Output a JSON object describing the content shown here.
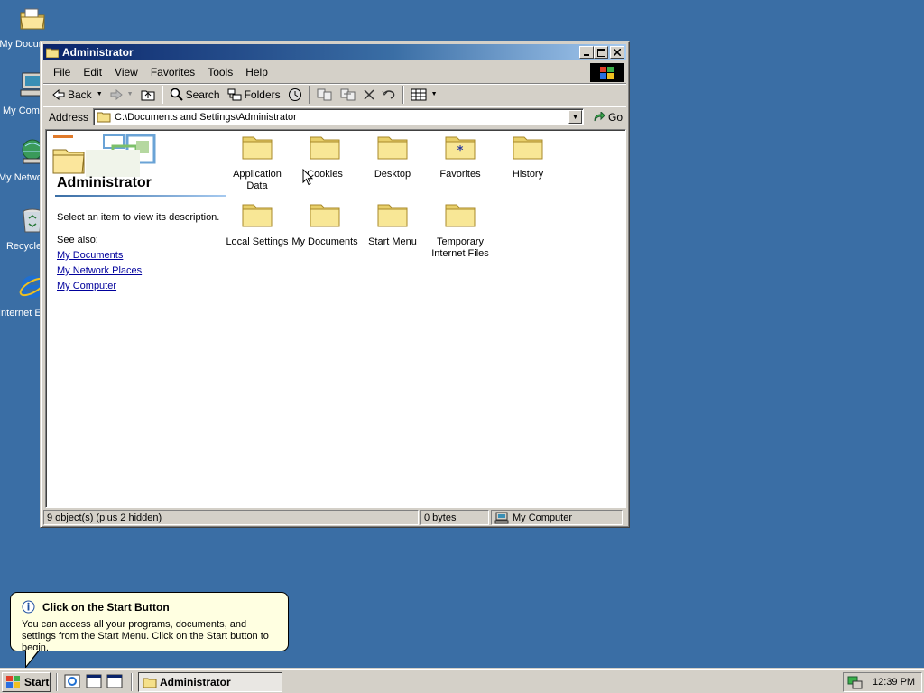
{
  "desktop": {
    "icons": [
      {
        "label": "My Documents",
        "icon": "my-documents-icon"
      },
      {
        "label": "My Computer",
        "icon": "my-computer-icon"
      },
      {
        "label": "My Network Places",
        "icon": "network-places-icon"
      },
      {
        "label": "Recycle Bin",
        "icon": "recycle-bin-icon"
      },
      {
        "label": "Internet Explorer",
        "icon": "internet-explorer-icon"
      }
    ]
  },
  "window": {
    "title": "Administrator",
    "menu": [
      "File",
      "Edit",
      "View",
      "Favorites",
      "Tools",
      "Help"
    ],
    "toolbar": {
      "back": "Back",
      "search": "Search",
      "folders": "Folders"
    },
    "address": {
      "label": "Address",
      "value": "C:\\Documents and Settings\\Administrator",
      "go": "Go"
    },
    "left_pane": {
      "title": "Administrator",
      "description": "Select an item to view its description.",
      "see_also": "See also:",
      "links": [
        "My Documents",
        "My Network Places",
        "My Computer"
      ]
    },
    "files": [
      {
        "line1": "Application",
        "line2": "Data"
      },
      {
        "line1": "Cookies",
        "line2": ""
      },
      {
        "line1": "Desktop",
        "line2": ""
      },
      {
        "line1": "Favorites",
        "line2": ""
      },
      {
        "line1": "History",
        "line2": ""
      },
      {
        "line1": "Local Settings",
        "line2": ""
      },
      {
        "line1": "My Documents",
        "line2": ""
      },
      {
        "line1": "Start Menu",
        "line2": ""
      },
      {
        "line1": "Temporary",
        "line2": "Internet Files"
      }
    ],
    "status": {
      "objects": "9 object(s) (plus 2 hidden)",
      "size": "0 bytes",
      "zone": "My Computer"
    }
  },
  "balloon": {
    "title": "Click on the Start Button",
    "text": "You can access all your programs, documents, and settings from the Start Menu. Click on the Start button to begin."
  },
  "taskbar": {
    "start": "Start",
    "task": "Administrator",
    "clock": "12:39 PM"
  },
  "colors": {
    "desktop": "#3a6ea5",
    "title_active": "#0a246a",
    "folder": "#f5e08a",
    "link": "#00009c"
  }
}
